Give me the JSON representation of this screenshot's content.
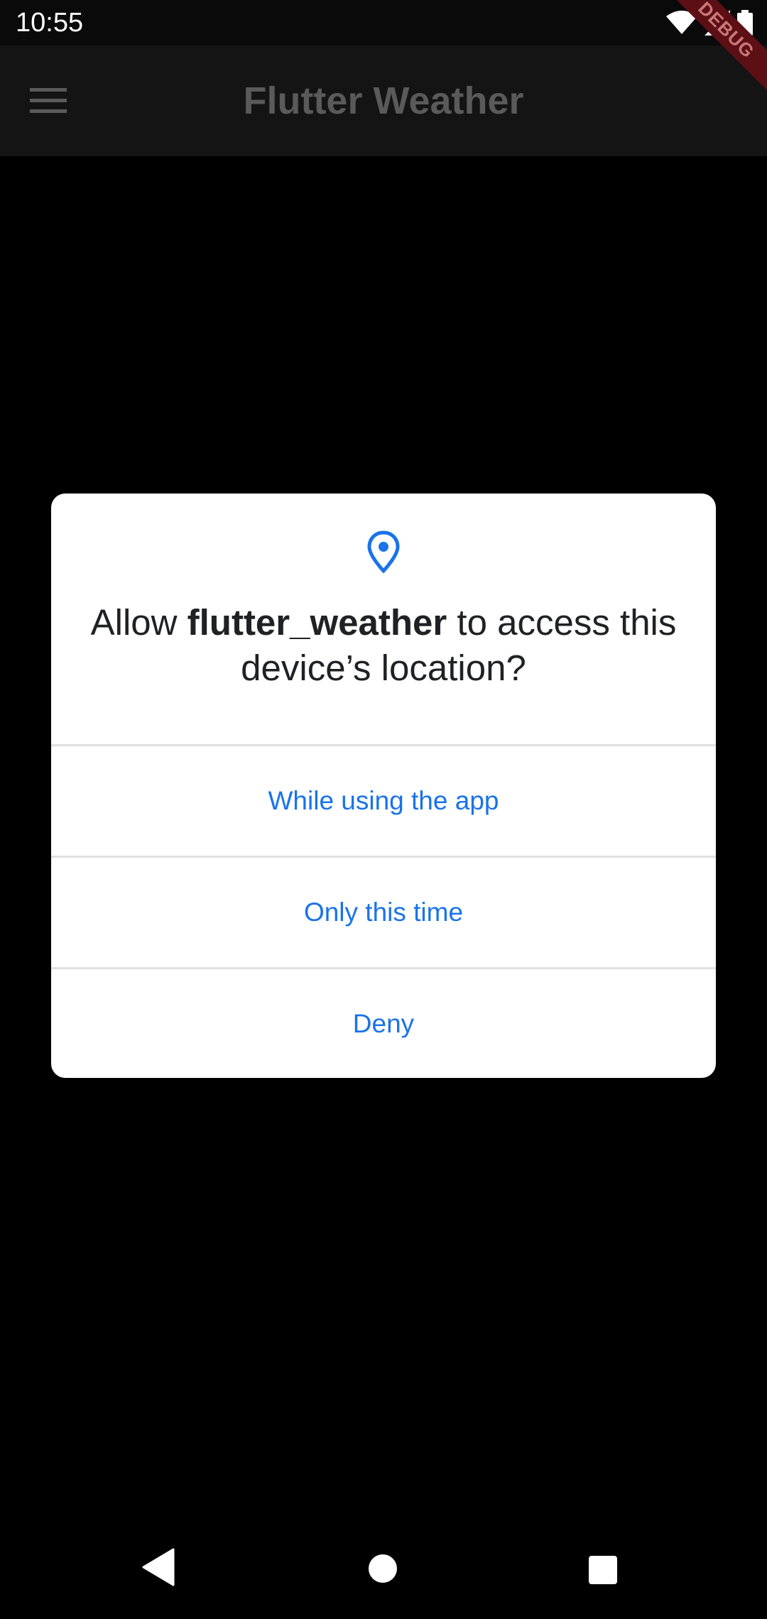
{
  "status_bar": {
    "time": "10:55",
    "icons": [
      "wifi-icon",
      "signal-icon",
      "battery-icon"
    ]
  },
  "app_bar": {
    "title": "Flutter Weather",
    "menu_icon": "hamburger-menu-icon",
    "debug_banner": "DEBUG"
  },
  "dialog": {
    "icon": "location-pin-icon",
    "title_prefix": "Allow ",
    "title_app": "flutter_weather",
    "title_suffix": " to access this device’s location?",
    "options": [
      {
        "label": "While using the app"
      },
      {
        "label": "Only this time"
      },
      {
        "label": "Deny"
      }
    ]
  },
  "nav_bar": {
    "back": "back-icon",
    "home": "home-icon",
    "recents": "recents-icon"
  },
  "colors": {
    "accent": "#1a73e8",
    "background": "#000000",
    "app_bar": "#141414",
    "dialog_bg": "#ffffff"
  }
}
